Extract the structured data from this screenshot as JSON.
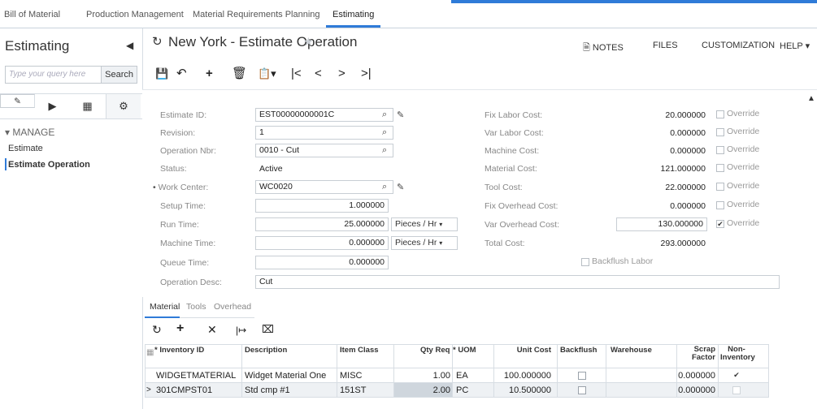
{
  "module_tabs": [
    "Bill of Material",
    "Production Management",
    "Material Requirements Planning",
    "Estimating"
  ],
  "left_panel": {
    "title": "Estimating",
    "search_placeholder": "Type your query here",
    "search_button": "Search",
    "section": "MANAGE",
    "items": [
      "Estimate",
      "Estimate Operation"
    ]
  },
  "header": {
    "title": "New York - Estimate Operation",
    "links": [
      "NOTES",
      "FILES",
      "CUSTOMIZATION",
      "HELP"
    ]
  },
  "form": {
    "estimate_id": {
      "label": "Estimate ID:",
      "value": "EST00000000001C"
    },
    "revision": {
      "label": "Revision:",
      "value": "1"
    },
    "operation_nbr": {
      "label": "Operation Nbr:",
      "value": "0010 - Cut"
    },
    "status": {
      "label": "Status:",
      "value": "Active"
    },
    "work_center": {
      "label": "Work Center:",
      "value": "WC0020"
    },
    "setup_time": {
      "label": "Setup Time:",
      "value": "1.000000"
    },
    "run_time": {
      "label": "Run Time:",
      "value": "25.000000",
      "unit": "Pieces / Hr"
    },
    "machine_time": {
      "label": "Machine Time:",
      "value": "0.000000",
      "unit": "Pieces / Hr"
    },
    "queue_time": {
      "label": "Queue Time:",
      "value": "0.000000"
    },
    "operation_desc": {
      "label": "Operation Desc:",
      "value": "Cut"
    },
    "costs": [
      {
        "label": "Fix Labor Cost:",
        "value": "20.000000",
        "override": false
      },
      {
        "label": "Var Labor Cost:",
        "value": "0.000000",
        "override": false
      },
      {
        "label": "Machine Cost:",
        "value": "0.000000",
        "override": false
      },
      {
        "label": "Material Cost:",
        "value": "121.000000",
        "override": false
      },
      {
        "label": "Tool Cost:",
        "value": "22.000000",
        "override": false
      },
      {
        "label": "Fix Overhead Cost:",
        "value": "0.000000",
        "override": false
      },
      {
        "label": "Var Overhead Cost:",
        "value": "130.000000",
        "override": true
      },
      {
        "label": "Total Cost:",
        "value": "293.000000"
      }
    ],
    "override_label": "Override",
    "backflush_labor": "Backflush Labor"
  },
  "tabs": [
    "Material",
    "Tools",
    "Overhead"
  ],
  "grid": {
    "columns": [
      "Inventory ID",
      "Description",
      "Item Class",
      "Qty Req",
      "UOM",
      "Unit Cost",
      "Backflush",
      "Warehouse",
      "Scrap Factor",
      "Non-Inventory"
    ],
    "rows": [
      {
        "inventory_id": "WIDGETMATERIAL",
        "description": "Widget Material One",
        "item_class": "MISC",
        "qty_req": "1.00",
        "uom": "EA",
        "unit_cost": "100.000000",
        "backflush": false,
        "warehouse": "",
        "scrap_factor": "0.000000",
        "non_inventory": true
      },
      {
        "inventory_id": "301CMPST01",
        "description": "Std cmp #1",
        "item_class": "151ST",
        "qty_req": "2.00",
        "uom": "PC",
        "unit_cost": "10.500000",
        "backflush": false,
        "warehouse": "",
        "scrap_factor": "0.000000",
        "non_inventory": false
      }
    ]
  },
  "colors": {
    "accent": "#2f7bd8",
    "active_row": "#eef1f4",
    "qty_highlight": "#cfd6dd"
  }
}
